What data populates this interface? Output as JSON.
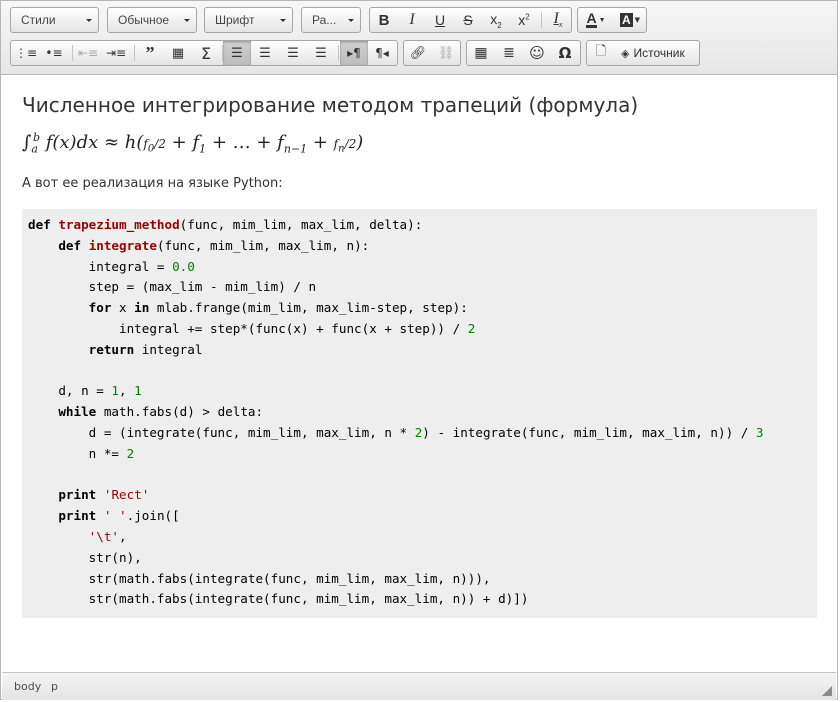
{
  "toolbar": {
    "styles_label": "Стили",
    "format_label": "Обычное",
    "font_label": "Шрифт",
    "size_label": "Ра...",
    "source_label": "Источник",
    "buttons": [
      "bold",
      "italic",
      "underline",
      "strike",
      "subscript",
      "superscript",
      "remove-format",
      "text-color",
      "bg-color",
      "numbered-list",
      "bulleted-list",
      "outdent",
      "indent",
      "blockquote",
      "div",
      "formula",
      "align-left",
      "align-center",
      "align-right",
      "justify",
      "ltr",
      "rtl",
      "link",
      "unlink",
      "table",
      "horizontal-rule",
      "smiley",
      "special-char",
      "preview",
      "source"
    ]
  },
  "content": {
    "heading": "Численное интегрирование методом трапеций (формула)",
    "intro": "А вот ее реализация на языке Python:"
  },
  "status": {
    "path_1": "body",
    "path_2": "p"
  }
}
